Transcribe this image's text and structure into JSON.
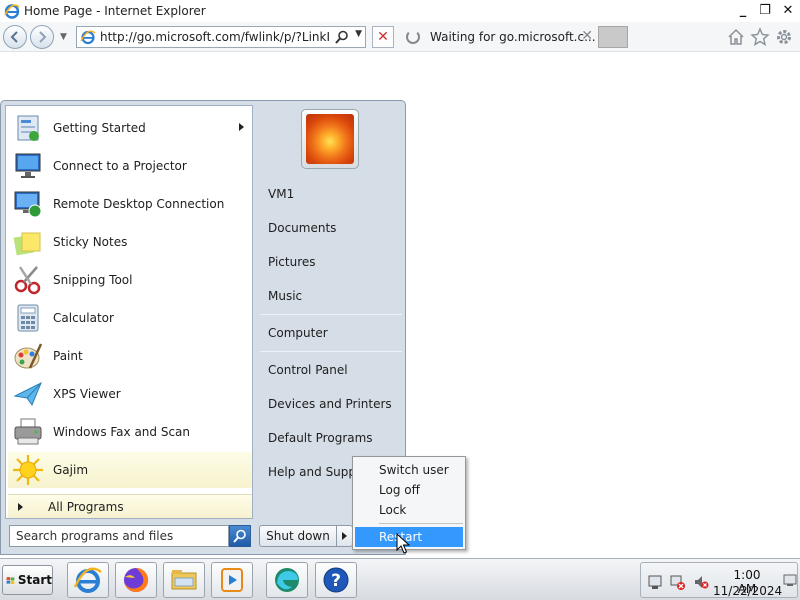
{
  "window": {
    "title": "Home Page - Internet Explorer",
    "minimize": "_",
    "restore": "❐",
    "close": "✕"
  },
  "toolbar": {
    "address": "http://go.microsoft.com/fwlink/p/?LinkId=",
    "stop": "✕",
    "tab_title": "Waiting for go.microsoft.c...",
    "tab_close": "✕"
  },
  "startmenu": {
    "programs": [
      {
        "label": "Getting Started",
        "icon": "getting-started-icon",
        "submenu": true
      },
      {
        "label": "Connect to a Projector",
        "icon": "projector-icon"
      },
      {
        "label": "Remote Desktop Connection",
        "icon": "remote-desktop-icon"
      },
      {
        "label": "Sticky Notes",
        "icon": "sticky-notes-icon"
      },
      {
        "label": "Snipping Tool",
        "icon": "snipping-tool-icon"
      },
      {
        "label": "Calculator",
        "icon": "calculator-icon"
      },
      {
        "label": "Paint",
        "icon": "paint-icon"
      },
      {
        "label": "XPS Viewer",
        "icon": "xps-viewer-icon"
      },
      {
        "label": "Windows Fax and Scan",
        "icon": "fax-scan-icon"
      },
      {
        "label": "Gajim",
        "icon": "gajim-icon",
        "highlighted": true
      }
    ],
    "all_programs": "All Programs",
    "search_placeholder": "Search programs and files",
    "right": {
      "user": "VM1",
      "documents": "Documents",
      "pictures": "Pictures",
      "music": "Music",
      "computer": "Computer",
      "control_panel": "Control Panel",
      "devices": "Devices and Printers",
      "default_programs": "Default Programs",
      "help": "Help and Support"
    },
    "shutdown": "Shut down",
    "power_menu": {
      "items": [
        "Switch user",
        "Log off",
        "Lock",
        "Restart"
      ],
      "selected": "Restart"
    }
  },
  "taskbar": {
    "start": "Start",
    "pinned": [
      "internet-explorer-icon",
      "firefox-icon",
      "file-explorer-icon",
      "media-player-icon",
      "edge-icon",
      "help-icon"
    ],
    "time": "1:00 AM",
    "date": "11/22/2024"
  },
  "colors": {
    "selection": "#3399ff",
    "highlight": "#f7f3cf",
    "menu_frame": "#d5dde6"
  }
}
